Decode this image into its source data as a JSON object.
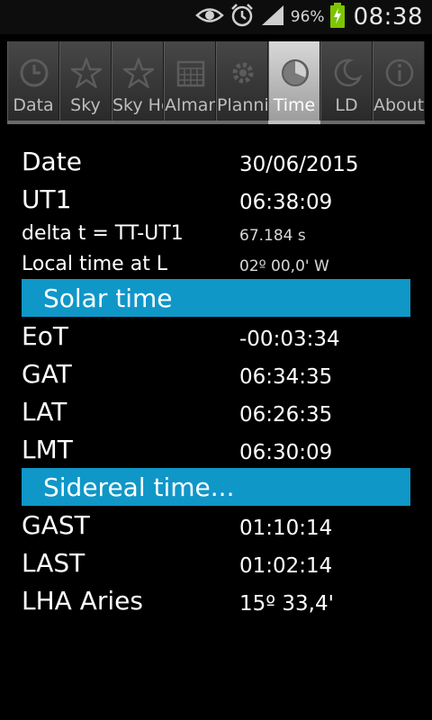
{
  "statusbar": {
    "battery_percent": "96%",
    "clock": "08:38",
    "icons": [
      "eye-icon",
      "alarm-clock-icon",
      "signal-icon",
      "battery-charging-icon"
    ]
  },
  "tabs": [
    {
      "label": "Data",
      "icon": "clock-icon"
    },
    {
      "label": "Sky",
      "icon": "star-icon"
    },
    {
      "label": "Sky Ho",
      "icon": "star-icon"
    },
    {
      "label": "Almana",
      "icon": "calendar-icon"
    },
    {
      "label": "Planni",
      "icon": "gear-icon"
    },
    {
      "label": "Time",
      "icon": "clock-icon",
      "active": true
    },
    {
      "label": "LD",
      "icon": "moon-icon"
    },
    {
      "label": "About",
      "icon": "info-icon"
    }
  ],
  "rows": {
    "date": {
      "label": "Date",
      "value": "30/06/2015"
    },
    "ut1": {
      "label": "UT1",
      "value": "06:38:09"
    },
    "delta_t": {
      "label": "delta t = TT-UT1",
      "value": "67.184 s"
    },
    "local_time": {
      "label": "Local time at L",
      "value": "02º 00,0' W"
    },
    "eot": {
      "label": "EoT",
      "value": "-00:03:34"
    },
    "gat": {
      "label": "GAT",
      "value": "06:34:35"
    },
    "lat": {
      "label": "LAT",
      "value": "06:26:35"
    },
    "lmt": {
      "label": "LMT",
      "value": "06:30:09"
    },
    "gast": {
      "label": "GAST",
      "value": "01:10:14"
    },
    "last": {
      "label": "LAST",
      "value": "01:02:14"
    },
    "lha_aries": {
      "label": "LHA Aries",
      "value": "15º 33,4'"
    }
  },
  "sections": {
    "solar": "Solar time",
    "sidereal": "Sidereal time..."
  },
  "colors": {
    "section_bg": "#0f97c8",
    "active_tab": "#bdbdbd",
    "background": "#000000"
  }
}
